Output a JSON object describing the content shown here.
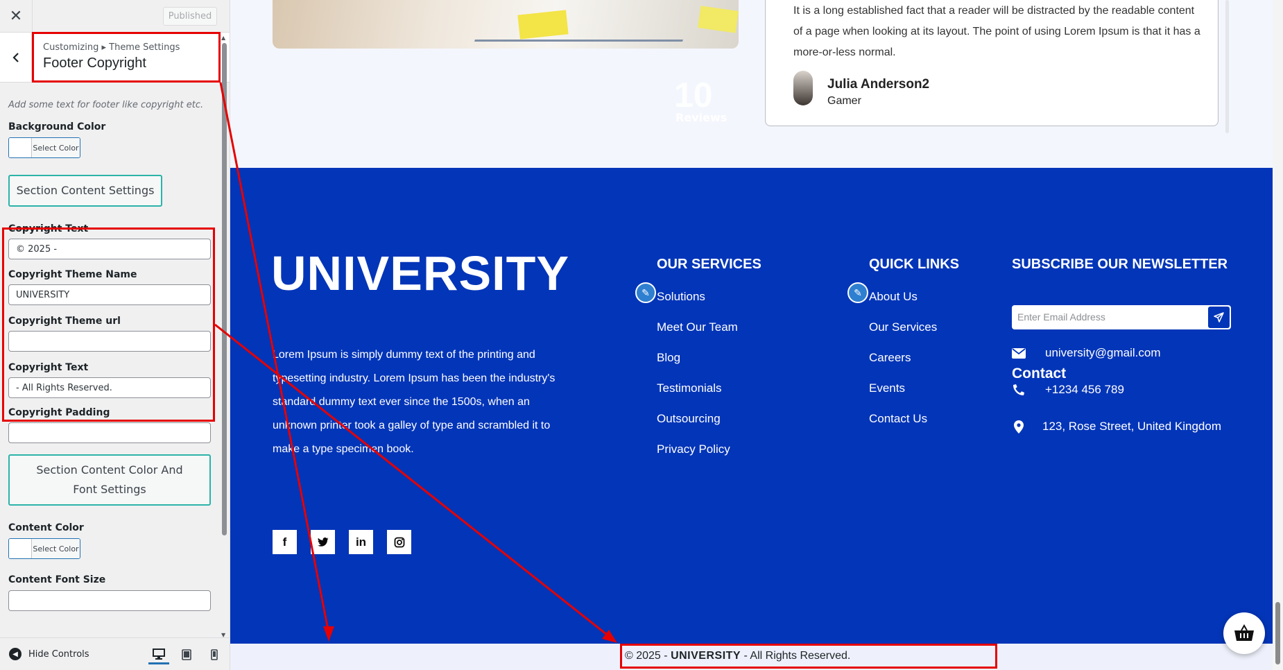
{
  "customizer": {
    "close_label": "✕",
    "published_label": "Published",
    "breadcrumb": "Customizing ▸ Theme Settings",
    "section_title": "Footer Copyright",
    "description": "Add some text for footer like copyright etc.",
    "background_color_label": "Background Color",
    "select_color_label": "Select Color",
    "section_content_settings_label": "Section Content Settings",
    "copyright_text_label": "Copyright Text",
    "copyright_text_value": "© 2025 -",
    "copyright_theme_name_label": "Copyright Theme Name",
    "copyright_theme_name_value": "UNIVERSITY",
    "copyright_theme_url_label": "Copyright Theme url",
    "copyright_theme_url_value": "",
    "copyright_text2_label": "Copyright Text",
    "copyright_text2_value": "- All Rights Reserved.",
    "copyright_padding_label": "Copyright Padding",
    "copyright_padding_value": "",
    "section_color_font_label": "Section Content Color And Font Settings",
    "content_color_label": "Content Color",
    "content_font_size_label": "Content Font Size",
    "hide_controls_label": "Hide Controls"
  },
  "preview": {
    "review": {
      "text": "It is a long established fact that a reader will be distracted by the readable content of a page when looking at its layout. The point of using Lorem Ipsum is that it has a more-or-less normal.",
      "name": "Julia Anderson2",
      "role": "Gamer",
      "count": "10",
      "count_label": "Reviews"
    },
    "footer": {
      "logo": "UNIVERSITY",
      "about": "Lorem Ipsum is simply dummy text of the printing and typesetting industry. Lorem Ipsum has been the industry's standard dummy text ever since the 1500s, when an unknown printer took a galley of type and scrambled it to make a type specimen book.",
      "services_title": "OUR SERVICES",
      "services": [
        "Solutions",
        "Meet Our Team",
        "Blog",
        "Testimonials",
        "Outsourcing",
        "Privacy Policy"
      ],
      "quick_title": "QUICK LINKS",
      "quick_links": [
        "About Us",
        "Our Services",
        "Careers",
        "Events",
        "Contact Us"
      ],
      "newsletter_title": "SUBSCRIBE OUR NEWSLETTER",
      "email_placeholder": "Enter Email Address",
      "contact_title": "Contact",
      "email": "university@gmail.com",
      "phone": "+1234 456 789",
      "address": "123, Rose Street, United Kingdom"
    },
    "copyright": {
      "prefix": "© 2025 -",
      "theme_name": "UNIVERSITY",
      "suffix": "- All Rights Reserved."
    }
  },
  "colors": {
    "footer_bg": "#0335b8",
    "annotation": "#e60000",
    "accent_teal": "#2bb3a8"
  }
}
